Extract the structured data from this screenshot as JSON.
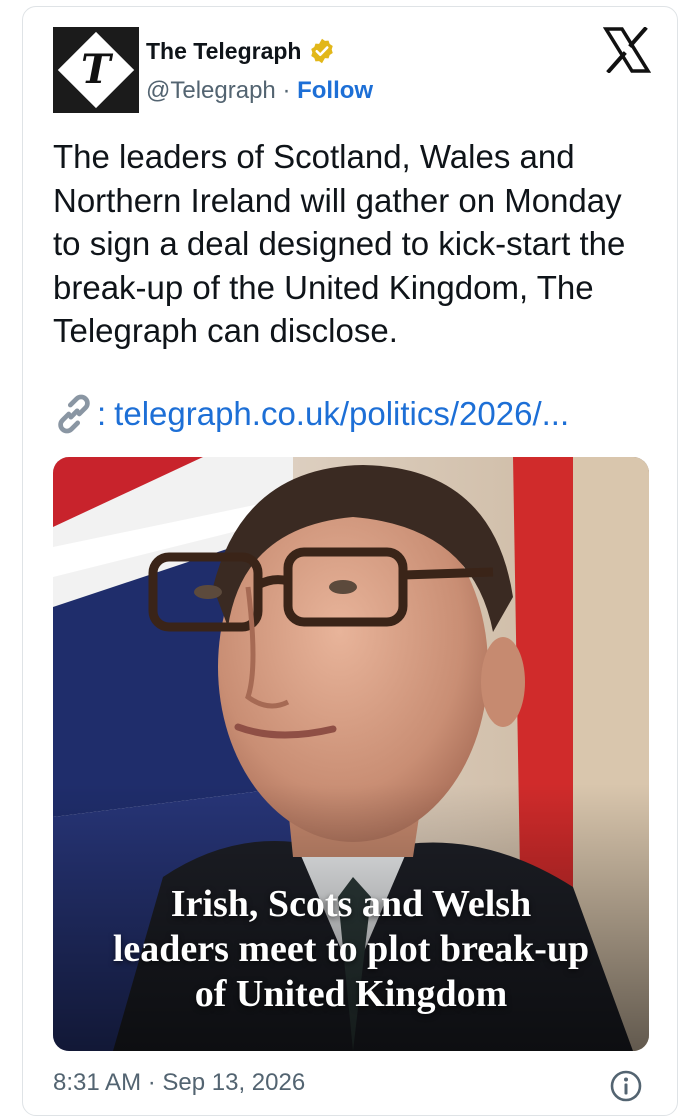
{
  "account": {
    "display_name": "The Telegraph",
    "handle": "@Telegraph",
    "separator": " · ",
    "follow_label": "Follow",
    "logo_letter": "T"
  },
  "tweet": {
    "text": "The leaders of Scotland, Wales and Northern Ireland will gather on Monday to sign a deal designed to kick-start the break-up of the United Kingdom, The Telegraph can disclose.",
    "link_prefix": ":",
    "link_text": "telegraph.co.uk/politics/2026/..."
  },
  "media": {
    "headline_line1": "Irish, Scots and Welsh",
    "headline_line2": "leaders meet to plot break-up",
    "headline_line3": "of United Kingdom"
  },
  "footer": {
    "timestamp": "8:31 AM · Sep 13, 2026"
  },
  "icons": {
    "verified": "verified-badge-icon",
    "x_logo": "x-logo-icon",
    "link": "link-icon",
    "info": "info-icon"
  },
  "colors": {
    "link_blue": "#1d6fd6",
    "muted": "#536471",
    "verified_gold": "#e2b719"
  }
}
